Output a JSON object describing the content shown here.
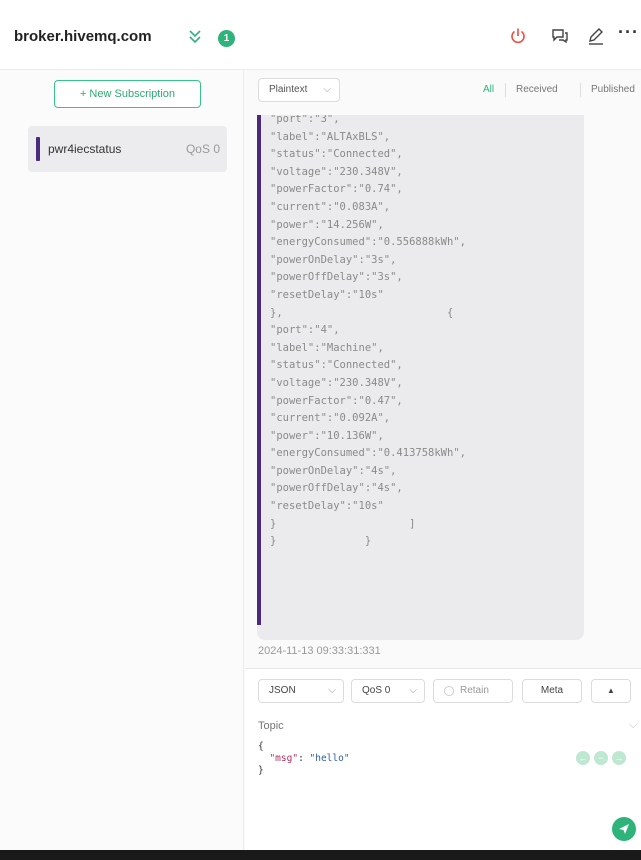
{
  "header": {
    "connection_name": "broker.hivemq.com",
    "subscription_count": "1",
    "icons": {
      "collapse": "chevron-double-down-icon",
      "disconnect": "power-icon",
      "chat": "chat-bubbles-icon",
      "edit": "pencil-icon",
      "more": "more-horizontal-icon"
    },
    "more_label": "···",
    "accent_color": "#2eb47a",
    "disconnect_color": "#f04a3e"
  },
  "sidebar": {
    "new_subscription_label": "+ New Subscription",
    "subscriptions": [
      {
        "topic": "pwr4iecstatus",
        "qos": "QoS 0",
        "color": "#4b2a7d"
      }
    ]
  },
  "toolbar": {
    "format": "Plaintext",
    "tabs": {
      "all": "All",
      "received": "Received",
      "published": "Published"
    }
  },
  "message": {
    "lines": [
      "\"port\":\"3\",",
      "\"label\":\"ALTAxBLS\",",
      "\"status\":\"Connected\",",
      "\"voltage\":\"230.348V\",",
      "\"powerFactor\":\"0.74\",",
      "\"current\":\"0.083A\",",
      "\"power\":\"14.256W\",",
      "\"energyConsumed\":\"0.556888kWh\",",
      "\"powerOnDelay\":\"3s\",",
      "\"powerOffDelay\":\"3s\",",
      "\"resetDelay\":\"10s\"",
      "},                          {",
      "\"port\":\"4\",",
      "\"label\":\"Machine\",",
      "\"status\":\"Connected\",",
      "\"voltage\":\"230.348V\",",
      "\"powerFactor\":\"0.47\",",
      "\"current\":\"0.092A\",",
      "\"power\":\"10.136W\",",
      "\"energyConsumed\":\"0.413758kWh\",",
      "\"powerOnDelay\":\"4s\",",
      "\"powerOffDelay\":\"4s\",",
      "\"resetDelay\":\"10s\"",
      "}                     ]",
      "}              }"
    ],
    "timestamp": "2024-11-13 09:33:31:331"
  },
  "composer": {
    "payload_format": "JSON",
    "qos": "QoS 0",
    "retain_label": "Retain",
    "meta_label": "Meta",
    "up_label": "▲",
    "topic_placeholder": "Topic",
    "payload_lines": [
      "{",
      "  \"msg\": \"hello\"",
      "}"
    ],
    "payload_key": "\"msg\"",
    "payload_value": "\"hello\"",
    "nav_prev": "←",
    "nav_reset": "−",
    "nav_next": "→"
  }
}
